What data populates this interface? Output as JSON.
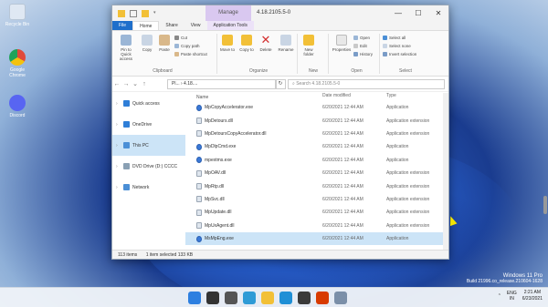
{
  "desktop": {
    "icons": [
      {
        "label": "Recycle Bin",
        "icon": "recycle-bin-icon",
        "color": "#dfe8f3"
      },
      {
        "label": "Google Chrome",
        "icon": "chrome-icon",
        "color": "#e04a3a"
      },
      {
        "label": "Discord",
        "icon": "discord-icon",
        "color": "#5865f2"
      }
    ],
    "watermark": {
      "line1": "Windows 11 Pro",
      "line2": "Build 21996.co_release.210604-1628"
    }
  },
  "window": {
    "title": "4.18.2105.5-0",
    "manage_label": "Manage",
    "tabs": [
      "File",
      "Home",
      "Share",
      "View",
      "Application Tools"
    ],
    "ribbon": {
      "pin_label": "Pin to Quick access",
      "copy_label": "Copy",
      "paste_label": "Paste",
      "cut_label": "Cut",
      "copy_path_label": "Copy path",
      "paste_shortcut_label": "Paste shortcut",
      "move_to_label": "Move to",
      "copy_to_label": "Copy to",
      "delete_label": "Delete",
      "rename_label": "Rename",
      "new_folder_label": "New folder",
      "properties_label": "Properties",
      "open_label": "Open",
      "edit_label": "Edit",
      "history_label": "History",
      "select_all_label": "Select all",
      "select_none_label": "Select none",
      "invert_selection_label": "Invert selection",
      "groups": [
        "Clipboard",
        "Organize",
        "New",
        "Open",
        "Select"
      ]
    },
    "address": {
      "path": "Pl... › 4.18....",
      "search_placeholder": "Search 4.18.2105.5-0"
    },
    "nav": [
      {
        "label": "Quick access",
        "icon": "star-icon",
        "color": "#2f7fd8"
      },
      {
        "label": "OneDrive",
        "icon": "cloud-icon",
        "color": "#2f7fd8"
      },
      {
        "label": "This PC",
        "icon": "computer-icon",
        "color": "#4b8fd6"
      },
      {
        "label": "DVD Drive (D:) CCCC",
        "icon": "dvd-icon",
        "color": "#8aa0b4"
      },
      {
        "label": "Network",
        "icon": "network-icon",
        "color": "#4b8fd6"
      }
    ],
    "columns": [
      "Name",
      "Date modified",
      "Type"
    ],
    "files": [
      {
        "name": "MpCopyAccelerator.exe",
        "date": "6/20/2021 12:44 AM",
        "type": "Application",
        "kind": "exe"
      },
      {
        "name": "MpDetours.dll",
        "date": "6/20/2021 12:44 AM",
        "type": "Application extension",
        "kind": "dll"
      },
      {
        "name": "MpDetoursCopyAccelerator.dll",
        "date": "6/20/2021 12:44 AM",
        "type": "Application extension",
        "kind": "dll"
      },
      {
        "name": "MpDlpCmd.exe",
        "date": "6/20/2021 12:44 AM",
        "type": "Application",
        "kind": "exe"
      },
      {
        "name": "mpextms.exe",
        "date": "6/20/2021 12:44 AM",
        "type": "Application",
        "kind": "exe"
      },
      {
        "name": "MpOAV.dll",
        "date": "6/20/2021 12:44 AM",
        "type": "Application extension",
        "kind": "dll"
      },
      {
        "name": "MpRtp.dll",
        "date": "6/20/2021 12:44 AM",
        "type": "Application extension",
        "kind": "dll"
      },
      {
        "name": "MpSvc.dll",
        "date": "6/20/2021 12:44 AM",
        "type": "Application extension",
        "kind": "dll"
      },
      {
        "name": "MpUpdate.dll",
        "date": "6/20/2021 12:44 AM",
        "type": "Application extension",
        "kind": "dll"
      },
      {
        "name": "MpUxAgent.dll",
        "date": "6/20/2021 12:44 AM",
        "type": "Application extension",
        "kind": "dll"
      },
      {
        "name": "MsMpEng.exe",
        "date": "6/20/2021 12:44 AM",
        "type": "Application",
        "kind": "exe",
        "selected": true
      }
    ],
    "status": {
      "count": "113 items",
      "selection": "1 item selected  133 KB"
    }
  },
  "taskbar": {
    "apps": [
      {
        "icon": "start-icon",
        "color": "#2d7fe0"
      },
      {
        "icon": "search-icon",
        "color": "#333333"
      },
      {
        "icon": "task-view-icon",
        "color": "#555555"
      },
      {
        "icon": "widgets-icon",
        "color": "#2f9bd6"
      },
      {
        "icon": "file-explorer-icon",
        "color": "#f2c037"
      },
      {
        "icon": "edge-icon",
        "color": "#1f8fd6"
      },
      {
        "icon": "store-icon",
        "color": "#3a3a3a"
      },
      {
        "icon": "office-icon",
        "color": "#d83b01"
      },
      {
        "icon": "mail-icon",
        "color": "#7b8fa8"
      }
    ],
    "lang": "ENG",
    "region": "IN",
    "time": "2:21 AM",
    "date": "6/23/2021"
  }
}
